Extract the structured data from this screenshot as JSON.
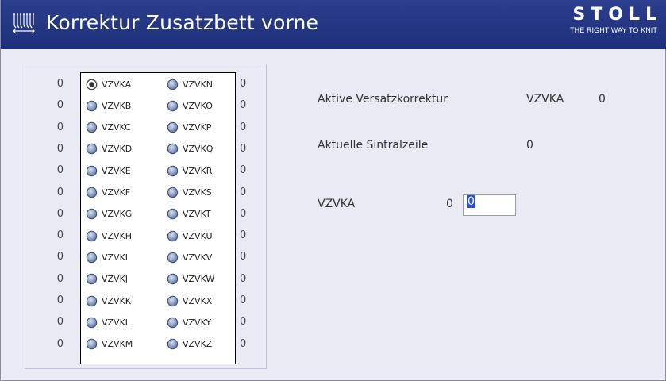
{
  "window": {
    "title": "Korrektur Zusatzbett vorne",
    "brand": "STOLL",
    "brand_tagline": "THE RIGHT WAY TO KNIT",
    "icon": "knitting-machine-icon"
  },
  "list": {
    "left_column": [
      {
        "label": "VZVKA",
        "value": "0",
        "selected": true
      },
      {
        "label": "VZVKB",
        "value": "0",
        "selected": false
      },
      {
        "label": "VZVKC",
        "value": "0",
        "selected": false
      },
      {
        "label": "VZVKD",
        "value": "0",
        "selected": false
      },
      {
        "label": "VZVKE",
        "value": "0",
        "selected": false
      },
      {
        "label": "VZVKF",
        "value": "0",
        "selected": false
      },
      {
        "label": "VZVKG",
        "value": "0",
        "selected": false
      },
      {
        "label": "VZVKH",
        "value": "0",
        "selected": false
      },
      {
        "label": "VZVKI",
        "value": "0",
        "selected": false
      },
      {
        "label": "VZVKJ",
        "value": "0",
        "selected": false
      },
      {
        "label": "VZVKK",
        "value": "0",
        "selected": false
      },
      {
        "label": "VZVKL",
        "value": "0",
        "selected": false
      },
      {
        "label": "VZVKM",
        "value": "0",
        "selected": false
      }
    ],
    "right_column": [
      {
        "label": "VZVKN",
        "value": "0"
      },
      {
        "label": "VZVKO",
        "value": "0"
      },
      {
        "label": "VZVKP",
        "value": "0"
      },
      {
        "label": "VZVKQ",
        "value": "0"
      },
      {
        "label": "VZVKR",
        "value": "0"
      },
      {
        "label": "VZVKS",
        "value": "0"
      },
      {
        "label": "VZVKT",
        "value": "0"
      },
      {
        "label": "VZVKU",
        "value": "0"
      },
      {
        "label": "VZVKV",
        "value": "0"
      },
      {
        "label": "VZVKW",
        "value": "0"
      },
      {
        "label": "VZVKX",
        "value": "0"
      },
      {
        "label": "VZVKY",
        "value": "0"
      },
      {
        "label": "VZVKZ",
        "value": "0"
      }
    ]
  },
  "info": {
    "active_label": "Aktive Versatzkorrektur",
    "active_name": "VZVKA",
    "active_value": "0",
    "sintral_label": "Aktuelle Sintralzeile",
    "sintral_value": "0"
  },
  "editor": {
    "label": "VZVKA",
    "current_value": "0",
    "input_value": "0"
  },
  "colors": {
    "titlebar": "#24358a",
    "background": "#eaeaf4",
    "selection": "#2a4fbf"
  }
}
